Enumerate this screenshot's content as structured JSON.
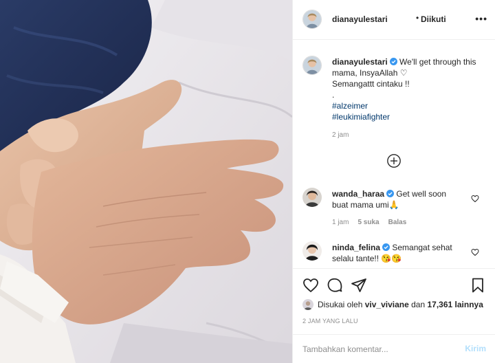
{
  "post": {
    "author": "dianayulestari",
    "dot": "•",
    "follow_label": "Diikuti",
    "more_label": "•••"
  },
  "caption": {
    "author": "dianayulestari",
    "line1": "We'll get through this mama, InsyaAllah ♡",
    "line2": "Semangattt cintaku !!",
    "line3": ".",
    "hashtags": [
      "#alzeimer",
      "#leukimiafighter"
    ],
    "time": "2 jam"
  },
  "comments": [
    {
      "user": "wanda_haraa",
      "text": "Get well soon buat mama umi🙏",
      "time": "1 jam",
      "likes": "5 suka",
      "reply": "Balas"
    },
    {
      "user": "ninda_felina",
      "text": "Semangat sehat selalu tante!! 😘😘"
    }
  ],
  "actions": {
    "liked_by_prefix": "Disukai oleh",
    "liked_by_user": "viv_viviane",
    "liked_by_and": "dan",
    "liked_by_count": "17,361 lainnya",
    "posted_ago": "2 JAM YANG LALU"
  },
  "add_comment": {
    "placeholder": "Tambahkan komentar...",
    "send_label": "Kirim"
  },
  "colors": {
    "verified": "#3897f0",
    "hashtag": "#00376b",
    "secondary_text": "#8e8e8e",
    "send_disabled": "#b2dffc"
  }
}
